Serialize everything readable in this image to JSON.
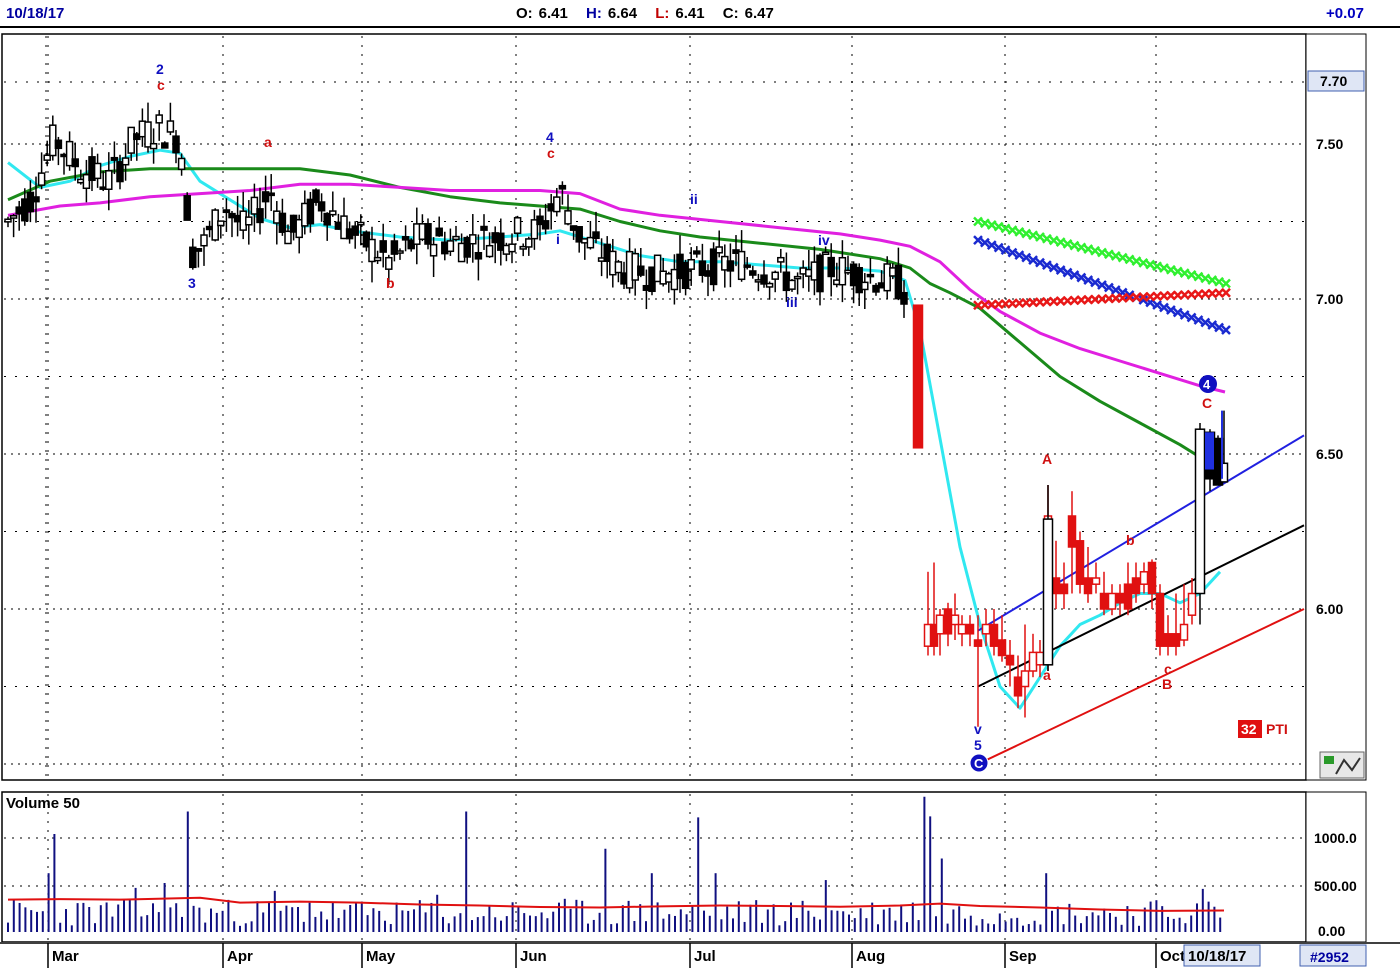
{
  "header": {
    "date": "10/18/17",
    "open_label": "O:",
    "open": "6.41",
    "high_label": "H:",
    "high": "6.64",
    "low_label": "L:",
    "low": "6.41",
    "close_label": "C:",
    "close": "6.47",
    "change": "+0.07"
  },
  "colors": {
    "up_candle": "#ffffff",
    "down_candle": "#000000",
    "recent_candle": "#e01010",
    "ma_fast": "#30e8f0",
    "ma_mid": "#1a8a1a",
    "ma_slow": "#e020e0",
    "channel_blue": "#2020e0",
    "channel_black": "#000000",
    "channel_red": "#e01010",
    "volume_bar": "#101080",
    "volume_ma": "#e01010"
  },
  "price_axis": {
    "ticks": [
      "7.50",
      "7.00",
      "6.50",
      "6.00"
    ],
    "current_price_tag": "7.70",
    "pti_value": "32",
    "pti_label": "PTI"
  },
  "volume_panel": {
    "title": "Volume 50",
    "ticks": [
      "1000.0",
      "500.00",
      "0.00"
    ]
  },
  "time_axis": {
    "months": [
      "Mar",
      "Apr",
      "May",
      "Jun",
      "Jul",
      "Aug",
      "Sep",
      "Oct"
    ],
    "cursor_date": "10/18/17",
    "code": "#2952"
  },
  "wave_labels": {
    "blue": [
      "2",
      "3",
      "4",
      "ii",
      "iii",
      "iv",
      "v",
      "5",
      "i"
    ],
    "red": [
      "c",
      "a",
      "b",
      "c",
      "A",
      "b",
      "C",
      "a",
      "c",
      "B"
    ],
    "circled": [
      "4",
      "C"
    ]
  },
  "chart_data": {
    "type": "candlestick",
    "title": "",
    "period": "Mar – Oct 2017, daily",
    "ylim": [
      5.5,
      7.9
    ],
    "series": [
      {
        "name": "price_key_points",
        "x": [
          "Mar",
          "mid-Mar",
          "Apr",
          "Apr",
          "Jun",
          "Jul",
          "Aug",
          "late-Aug",
          "early-Sep",
          "mid-Sep",
          "early-Oct",
          "10/18/17"
        ],
        "values": [
          7.25,
          7.58,
          7.15,
          7.28,
          7.2,
          7.1,
          7.05,
          5.85,
          5.85,
          6.3,
          5.85,
          6.47
        ]
      },
      {
        "name": "volume_ma",
        "values_approx": [
          330,
          340,
          300,
          280,
          250,
          260,
          270,
          240,
          210
        ]
      },
      {
        "name": "projection_green",
        "from": 7.25,
        "to": 7.05
      },
      {
        "name": "projection_blue",
        "from": 7.18,
        "to": 6.9
      },
      {
        "name": "projection_red",
        "from": 6.98,
        "to": 7.02
      }
    ],
    "volume_ylim": [
      0,
      1400
    ],
    "grid": true,
    "legend": "none"
  }
}
